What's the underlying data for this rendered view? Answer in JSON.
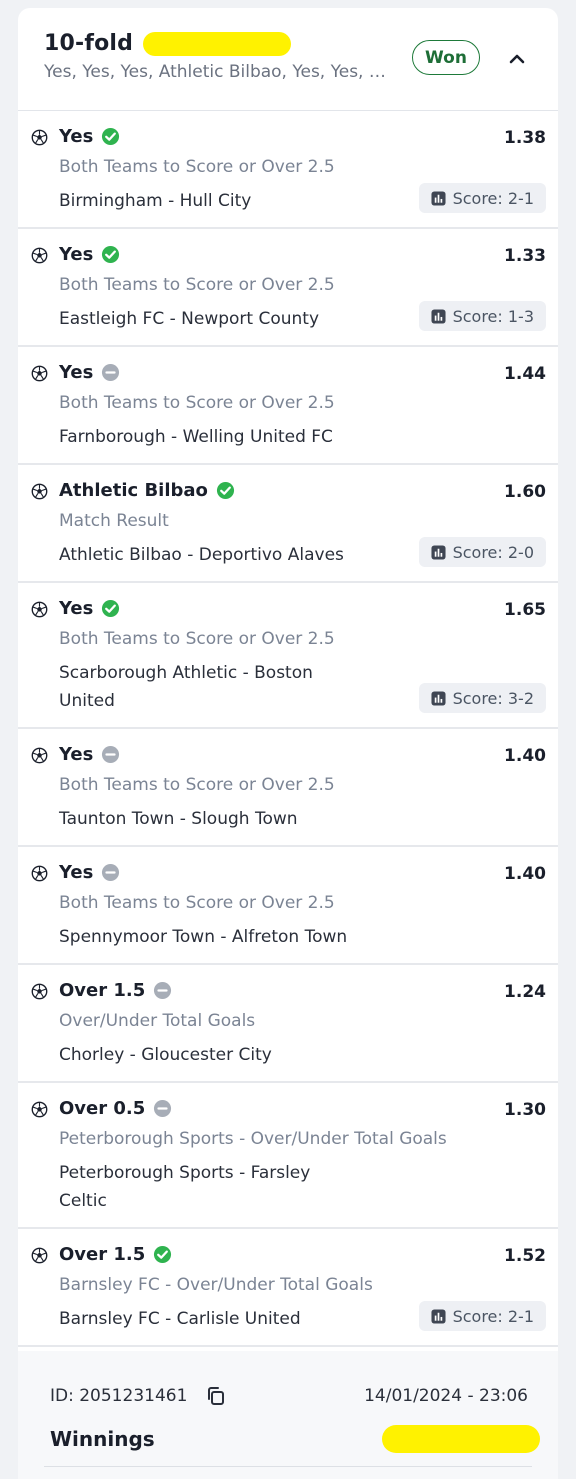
{
  "bet": {
    "title": "10-fold",
    "summary": "Yes, Yes, Yes, Athletic Bilbao, Yes, Yes, …",
    "status": "Won"
  },
  "legs": [
    {
      "selection": "Yes",
      "result": "won",
      "odds": "1.38",
      "market": "Both Teams to Score or Over 2.5",
      "event": "Birmingham - Hull City",
      "score": "Score: 2-1"
    },
    {
      "selection": "Yes",
      "result": "won",
      "odds": "1.33",
      "market": "Both Teams to Score or Over 2.5",
      "event": "Eastleigh FC - Newport County",
      "score": "Score: 1-3"
    },
    {
      "selection": "Yes",
      "result": "void",
      "odds": "1.44",
      "market": "Both Teams to Score or Over 2.5",
      "event": "Farnborough - Welling United FC",
      "score": ""
    },
    {
      "selection": "Athletic Bilbao",
      "result": "won",
      "odds": "1.60",
      "market": "Match Result",
      "event": "Athletic Bilbao - Deportivo Alaves",
      "score": "Score: 2-0"
    },
    {
      "selection": "Yes",
      "result": "won",
      "odds": "1.65",
      "market": "Both Teams to Score or Over 2.5",
      "event": "Scarborough Athletic - Boston United",
      "score": "Score: 3-2"
    },
    {
      "selection": "Yes",
      "result": "void",
      "odds": "1.40",
      "market": "Both Teams to Score or Over 2.5",
      "event": "Taunton Town - Slough Town",
      "score": ""
    },
    {
      "selection": "Yes",
      "result": "void",
      "odds": "1.40",
      "market": "Both Teams to Score or Over 2.5",
      "event": "Spennymoor Town - Alfreton Town",
      "score": ""
    },
    {
      "selection": "Over 1.5",
      "result": "void",
      "odds": "1.24",
      "market": "Over/Under Total Goals",
      "event": "Chorley - Gloucester City",
      "score": ""
    },
    {
      "selection": "Over 0.5",
      "result": "void",
      "odds": "1.30",
      "market": "Peterborough Sports - Over/Under Total Goals",
      "event": "Peterborough Sports - Farsley Celtic",
      "score": ""
    },
    {
      "selection": "Over 1.5",
      "result": "won",
      "odds": "1.52",
      "market": "Barnsley FC - Over/Under Total Goals",
      "event": "Barnsley FC - Carlisle United",
      "score": "Score: 2-1"
    }
  ],
  "footer": {
    "id": "ID: 2051231461",
    "datetime": "14/01/2024 - 23:06",
    "winnings_label": "Winnings"
  },
  "colors": {
    "won": "#2fb34f",
    "void": "#a7adb7",
    "highlight": "#fff200",
    "badge": "#1e7a3a"
  },
  "icons": {
    "sport": "football-icon",
    "won": "check-circle-icon",
    "void": "minus-circle-icon",
    "score": "stats-chart-icon",
    "copy": "copy-icon",
    "collapse": "chevron-up-icon"
  }
}
